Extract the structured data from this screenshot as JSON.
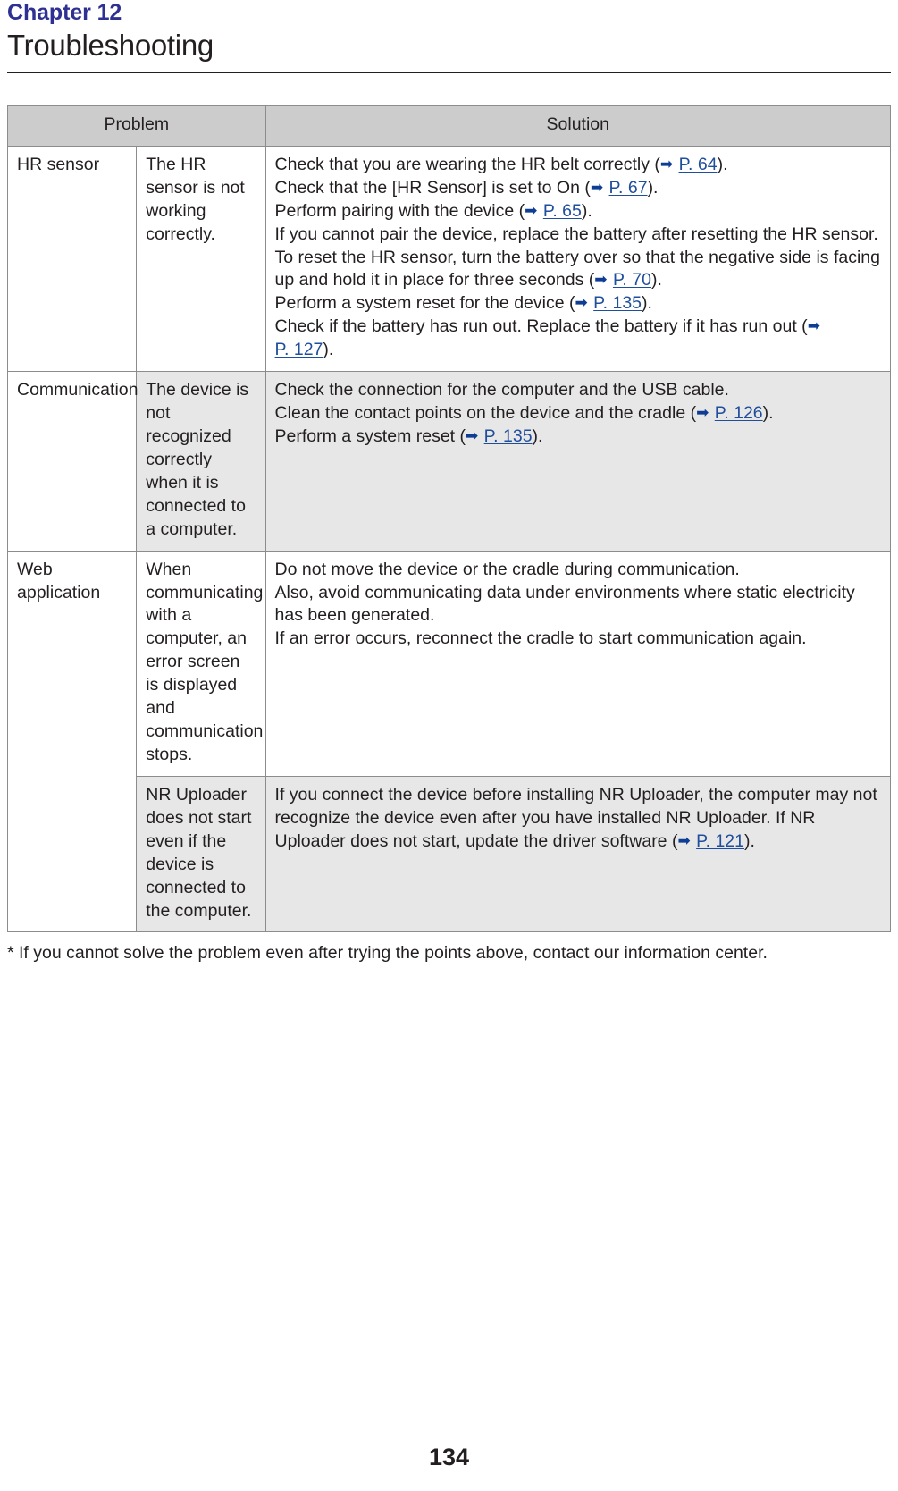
{
  "header": {
    "chapter_label": "Chapter 12",
    "chapter_title": "Troubleshooting"
  },
  "colors": {
    "chapter_accent": "#2e3192",
    "link": "#1f4e9c",
    "arrow": "#0d3e94",
    "header_row_bg": "#cccccc",
    "shaded_row_bg": "#e7e7e7",
    "border": "#8c8c8c",
    "text": "#231f20"
  },
  "table": {
    "headers": {
      "problem": "Problem",
      "solution": "Solution"
    },
    "rows": [
      {
        "category": "HR sensor",
        "shaded": false,
        "problem": "The HR sensor is not working correctly.",
        "solution_lines": [
          {
            "before": "Check that you are wearing the HR belt correctly (",
            "arrow": "➡",
            "link": "P. 64",
            "after": ")."
          },
          {
            "before": "Check that the [HR Sensor] is set to On (",
            "arrow": "➡",
            "link": "P. 67",
            "after": ")."
          },
          {
            "before": "Perform pairing with the device (",
            "arrow": "➡",
            "link": "P. 65",
            "after": ")."
          },
          {
            "before": "If you cannot pair the device, replace the battery after resetting the HR sensor. To reset the HR sensor, turn the battery over so that the negative side is facing up and hold it in place for three seconds (",
            "arrow": "➡",
            "link": "P. 70",
            "after": ")."
          },
          {
            "before": "Perform a system reset for the device (",
            "arrow": "➡",
            "link": "P. 135",
            "after": ")."
          },
          {
            "before": "Check if the battery has run out. Replace the battery if it has run out (",
            "arrow": "➡",
            "link": "P. 127",
            "after": ")."
          }
        ]
      },
      {
        "category": "Communication",
        "shaded": true,
        "problem": "The device is not recognized correctly when it is connected to a computer.",
        "solution_lines": [
          {
            "before": "Check the connection for the computer and the USB cable.",
            "arrow": "",
            "link": "",
            "after": ""
          },
          {
            "before": "Clean the contact points on the device and the cradle (",
            "arrow": "➡",
            "link": "P. 126",
            "after": ")."
          },
          {
            "before": "Perform a system reset (",
            "arrow": "➡",
            "link": "P. 135",
            "after": ")."
          }
        ]
      },
      {
        "category": "Web application",
        "shaded": false,
        "problem": "When communicating with a computer, an error screen is displayed and communication stops.",
        "solution_lines": [
          {
            "before": "Do not move the device or the cradle during communication.",
            "arrow": "",
            "link": "",
            "after": ""
          },
          {
            "before": "Also, avoid communicating data under environments where static electricity has been generated.",
            "arrow": "",
            "link": "",
            "after": ""
          },
          {
            "before": "If an error occurs, reconnect the cradle to start communication again.",
            "arrow": "",
            "link": "",
            "after": ""
          }
        ]
      },
      {
        "category": "",
        "shaded": true,
        "problem": "NR Uploader does not start even if the device is connected to the computer.",
        "solution_lines": [
          {
            "before": "If you connect the device before installing NR Uploader, the computer may not recognize the device even after you have installed NR Uploader. If NR Uploader does not start, update the driver software (",
            "arrow": "➡",
            "link": "P. 121",
            "after": ")."
          }
        ]
      }
    ]
  },
  "footnote": "* If you cannot solve the problem even after trying the points above, contact our information center.",
  "page_number": "134"
}
